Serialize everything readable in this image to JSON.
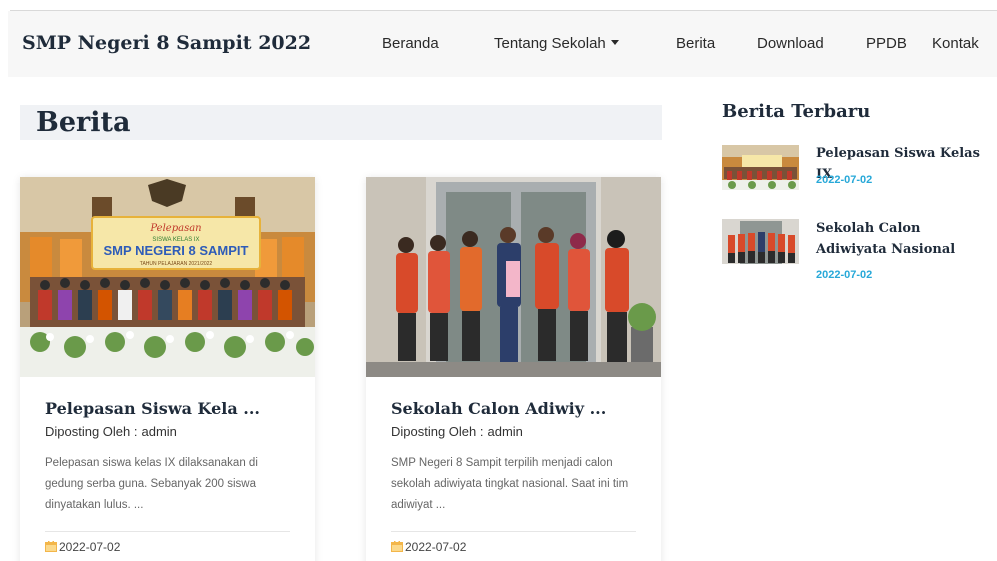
{
  "header": {
    "brand": "SMP Negeri 8 Sampit 2022",
    "nav": [
      "Beranda",
      "Tentang Sekolah",
      "Berita",
      "Download",
      "PPDB",
      "Kontak"
    ]
  },
  "page": {
    "title": "Berita"
  },
  "posts": [
    {
      "title": "Pelepasan Siswa Kela ...",
      "author_label": "Diposting Oleh :",
      "author": "admin",
      "excerpt": "Pelepasan siswa kelas IX dilaksanakan di gedung serba guna. Sebanyak 200 siswa dinyatakan lulus. ...",
      "date": "2022-07-02",
      "banner_lines": [
        "Pelepasan",
        "SISWA KELAS IX",
        "SMP NEGERI 8 SAMPIT",
        "TAHUN PELAJARAN 2021/2022"
      ]
    },
    {
      "title": "Sekolah Calon Adiwiy ...",
      "author_label": "Diposting Oleh :",
      "author": "admin",
      "excerpt": "SMP Negeri 8 Sampit terpilih menjadi calon sekolah adiwiyata tingkat nasional. Saat ini tim adiwiyat ...",
      "date": "2022-07-02"
    }
  ],
  "sidebar": {
    "title": "Berita Terbaru",
    "items": [
      {
        "title": "Pelepasan Siswa Kelas IX",
        "date": "2022-07-02"
      },
      {
        "title": "Sekolah Calon Adiwiyata Nasional",
        "date": "2022-07-02"
      }
    ]
  },
  "colors": {
    "accent": "#27a8d8",
    "heading": "#1f2b3a",
    "calendar": "#f3b64a"
  }
}
